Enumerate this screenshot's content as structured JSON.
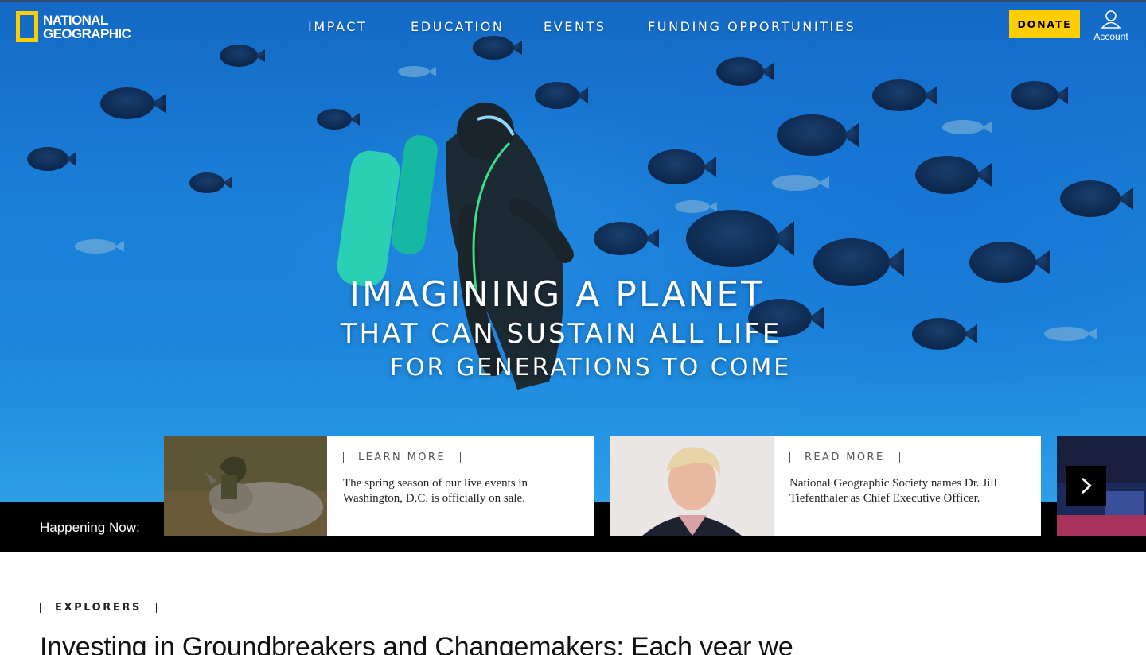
{
  "header": {
    "logo_text_line1": "National",
    "logo_text_line2": "Geographic",
    "nav": [
      {
        "label": "Impact"
      },
      {
        "label": "Education"
      },
      {
        "label": "Events"
      },
      {
        "label": "Funding Opportunities"
      }
    ],
    "donate_label": "Donate",
    "account_label": "Account"
  },
  "hero": {
    "line1": "IMAGINING A PLANET",
    "line2": "THAT CAN SUSTAIN ALL LIFE",
    "line3": "FOR GENERATIONS TO COME"
  },
  "happening": {
    "label": "Happening Now:",
    "cards": [
      {
        "link": "Learn More",
        "text": "The spring season of our live events in Washington, D.C. is officially on sale."
      },
      {
        "link": "Read More",
        "text": "National Geographic Society names Dr. Jill Tiefenthaler as Chief Executive Officer."
      }
    ]
  },
  "section": {
    "tag": "Explorers",
    "headline": "Investing in Groundbreakers and Changemakers: Each year we"
  },
  "colors": {
    "brand_yellow": "#ffce00",
    "ocean_blue": "#1a7fd8"
  },
  "icons": {
    "account": "person-outline-icon",
    "next": "chevron-right-icon"
  }
}
